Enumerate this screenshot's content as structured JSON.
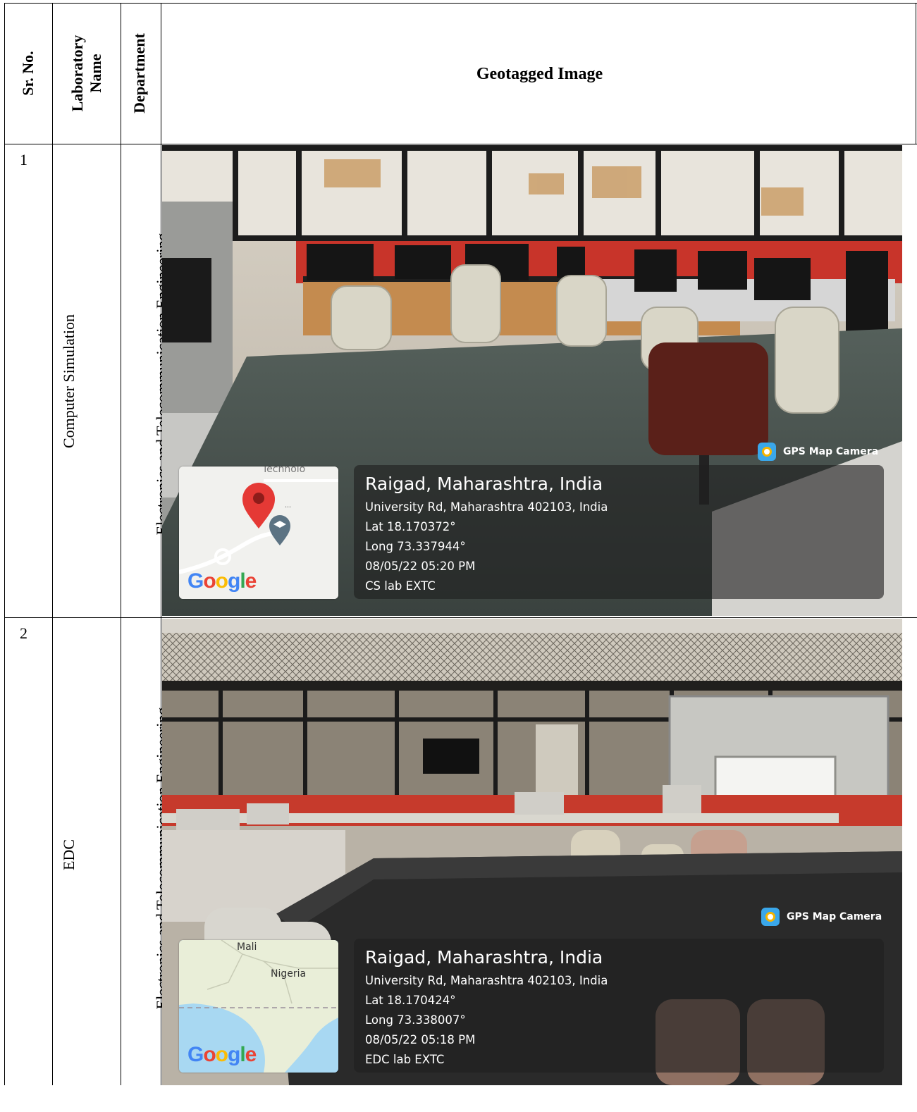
{
  "header": {
    "sr_no": "Sr. No.",
    "lab_name_line1": "Laboratory",
    "lab_name_line2": "Name",
    "department": "Department",
    "geotagged_image": "Geotagged Image"
  },
  "rows": [
    {
      "sr": "1",
      "lab": "Computer Simulation",
      "department": "Electronics and Telecommunication Engineering",
      "gps_label": "GPS Map Camera",
      "map_text": "Technolo",
      "location_title": "Raigad, Maharashtra, India",
      "address": "University Rd, Maharashtra 402103, India",
      "lat": "Lat 18.170372°",
      "long": "Long 73.337944°",
      "datetime": "08/05/22 05:20 PM",
      "note": "CS lab EXTC",
      "google": "Google"
    },
    {
      "sr": "2",
      "lab": "EDC",
      "department": "Electronics and Telecommunication Engineering",
      "gps_label": "GPS Map Camera",
      "map_label_1": "Mali",
      "map_label_2": "Nigeria",
      "location_title": "Raigad, Maharashtra, India",
      "address": "University Rd, Maharashtra 402103, India",
      "lat": "Lat 18.170424°",
      "long": "Long 73.338007°",
      "datetime": "08/05/22 05:18 PM",
      "note": "EDC lab EXTC",
      "google": "Google"
    }
  ]
}
